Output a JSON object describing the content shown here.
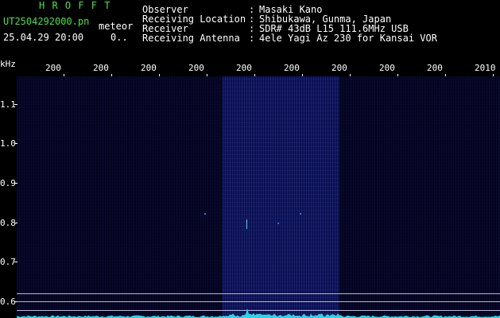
{
  "header": {
    "title": "H R O F F T",
    "filename": "UT2504292000.pn",
    "mode": "meteor",
    "datetime": "25.04.29 20:00",
    "counter": "0.."
  },
  "info": [
    {
      "label": "Observer",
      "value": "Masaki Kano"
    },
    {
      "label": "Receiving Location",
      "value": "Shibukawa, Gunma, Japan"
    },
    {
      "label": "Receiver",
      "value": "SDR# 43dB L15 111.6MHz USB"
    },
    {
      "label": "Receiving Antenna",
      "value": "4ele Yagi Az 230 for Kansai VOR"
    }
  ],
  "axis": {
    "unit": "kHz",
    "y_ticks": [
      "1.1",
      "1.0",
      "0.9",
      "0.8",
      "0.7",
      "0.6"
    ],
    "x_ticks": [
      "200",
      "200",
      "200",
      "200",
      "200",
      "200",
      "200",
      "200",
      "200",
      "2010"
    ]
  },
  "colors": {
    "title_green": "#49e14a",
    "signal_cyan": "#2fd3e6",
    "background": "#040420",
    "band": "#0b1050"
  }
}
